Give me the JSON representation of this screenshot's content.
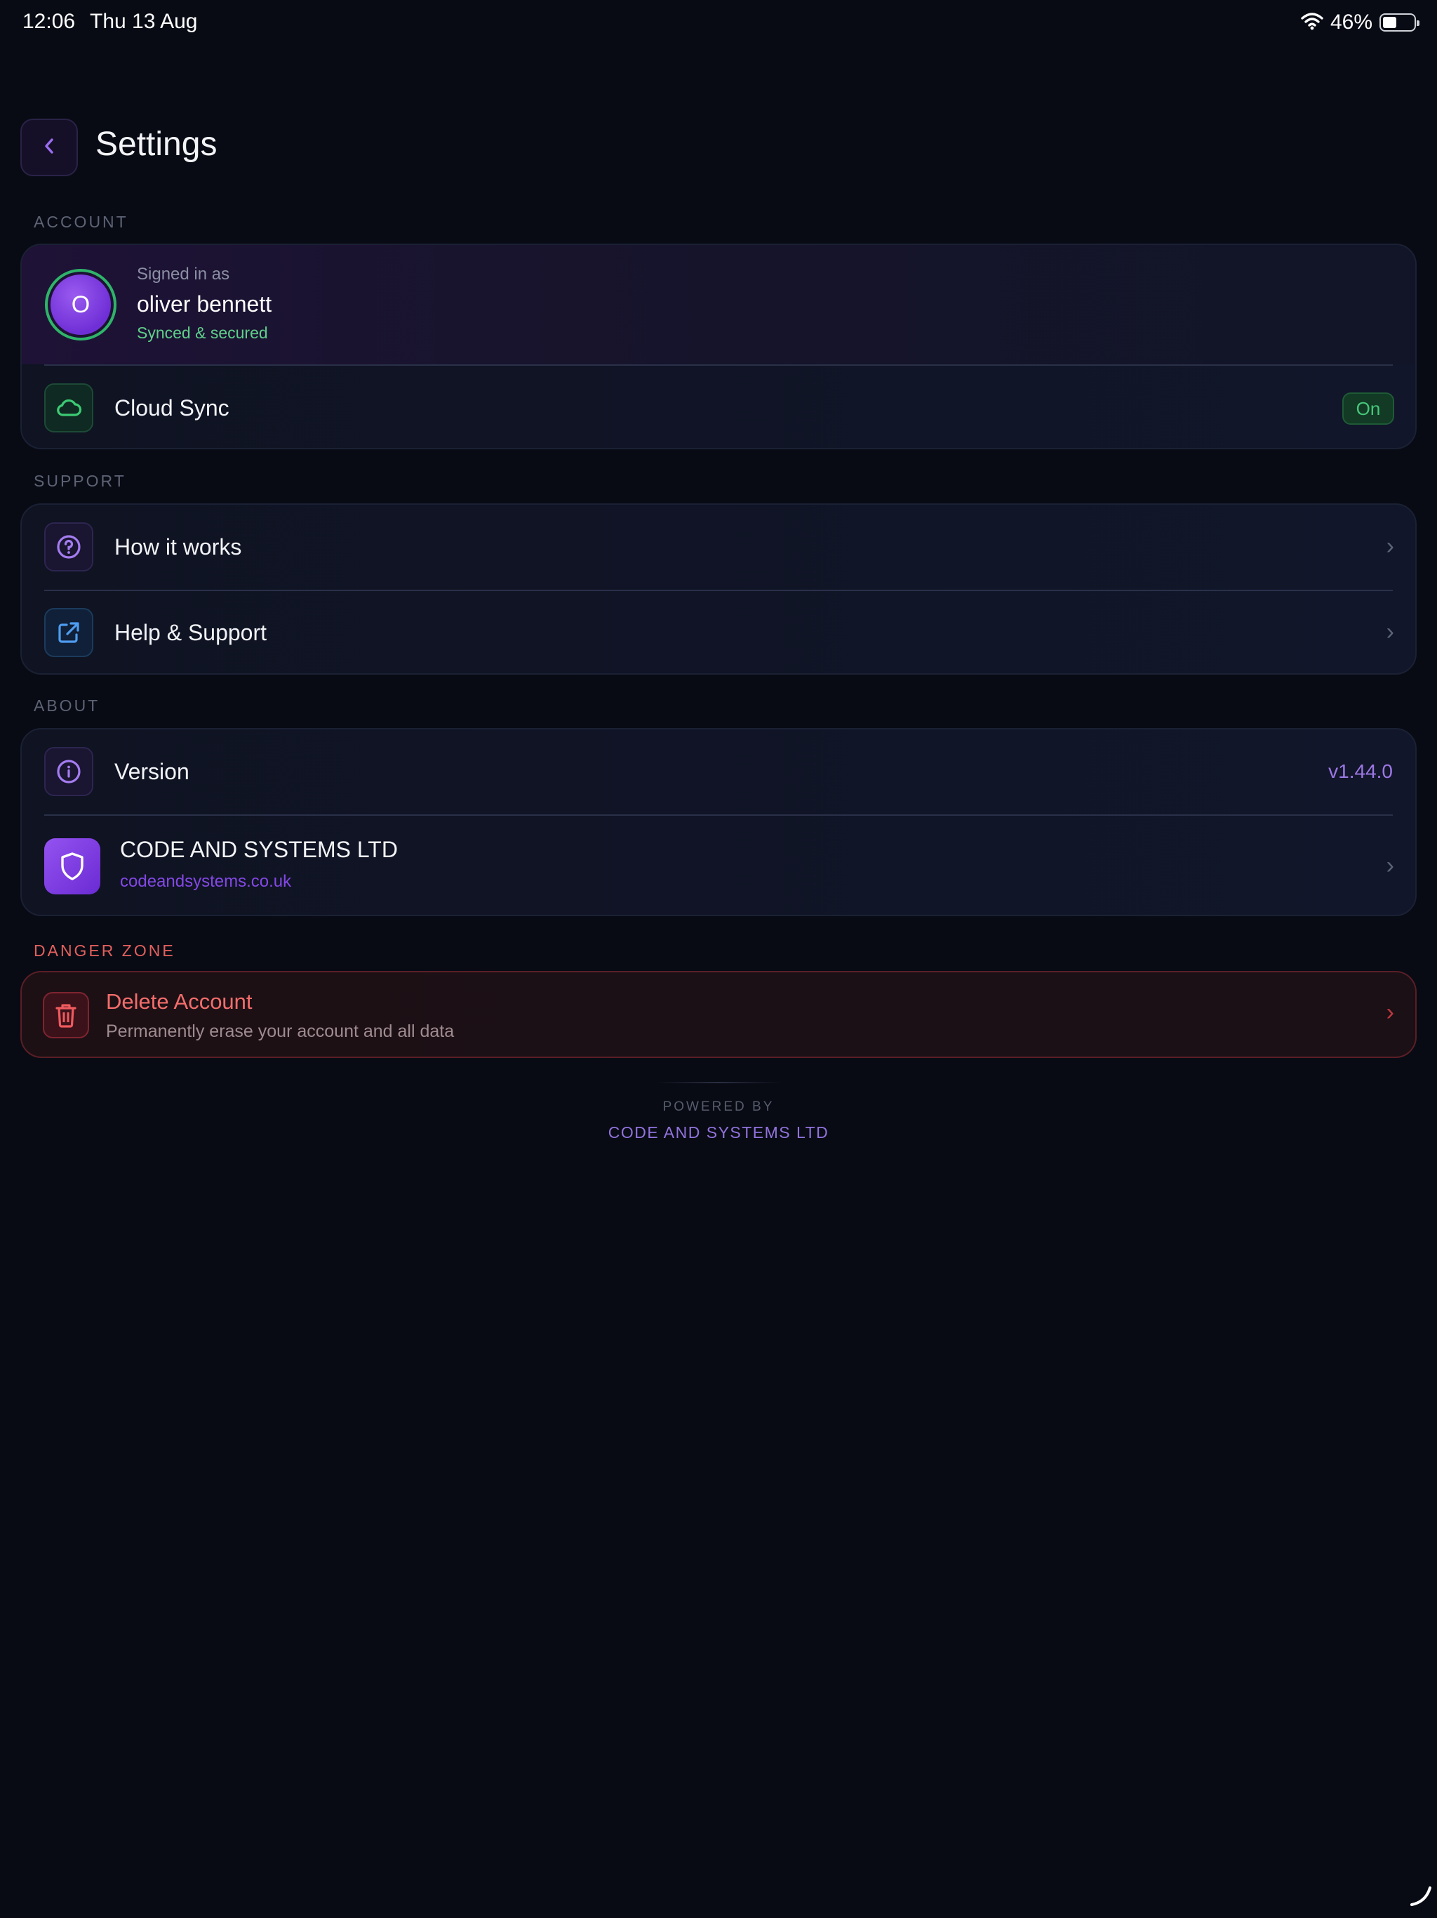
{
  "status_bar": {
    "time": "12:06",
    "date": "Thu 13 Aug",
    "battery_percent": "46%",
    "battery_level": 0.46,
    "icons": [
      "wifi-icon",
      "battery-icon"
    ]
  },
  "header": {
    "title": "Settings",
    "back_icon": "chevron-left-icon"
  },
  "sections": {
    "account": "ACCOUNT",
    "support": "SUPPORT",
    "about": "ABOUT",
    "danger": "DANGER ZONE"
  },
  "account": {
    "avatar_initial": "O",
    "signed_in_label": "Signed in as",
    "user_name": "oliver bennett",
    "sync_status": "Synced & secured"
  },
  "cloud_sync": {
    "label": "Cloud Sync",
    "state": "On",
    "icon": "cloud-icon"
  },
  "support": {
    "items": [
      {
        "label": "How it works",
        "icon": "question-icon"
      },
      {
        "label": "Help & Support",
        "icon": "external-link-icon"
      }
    ]
  },
  "about": {
    "version_label": "Version",
    "version_value": "v1.44.0",
    "company_name": "CODE AND SYSTEMS LTD",
    "company_url": "codeandsystems.co.uk",
    "company_icon": "shield-icon"
  },
  "danger": {
    "title": "Delete Account",
    "subtitle": "Permanently erase your account and all data",
    "icon": "trash-icon"
  },
  "footer": {
    "powered_by": "POWERED BY",
    "company": "CODE AND SYSTEMS LTD"
  },
  "colors": {
    "background": "#080b14",
    "accent_purple": "#8448e6",
    "success_green": "#46c779",
    "danger_red": "#f36d6b"
  }
}
